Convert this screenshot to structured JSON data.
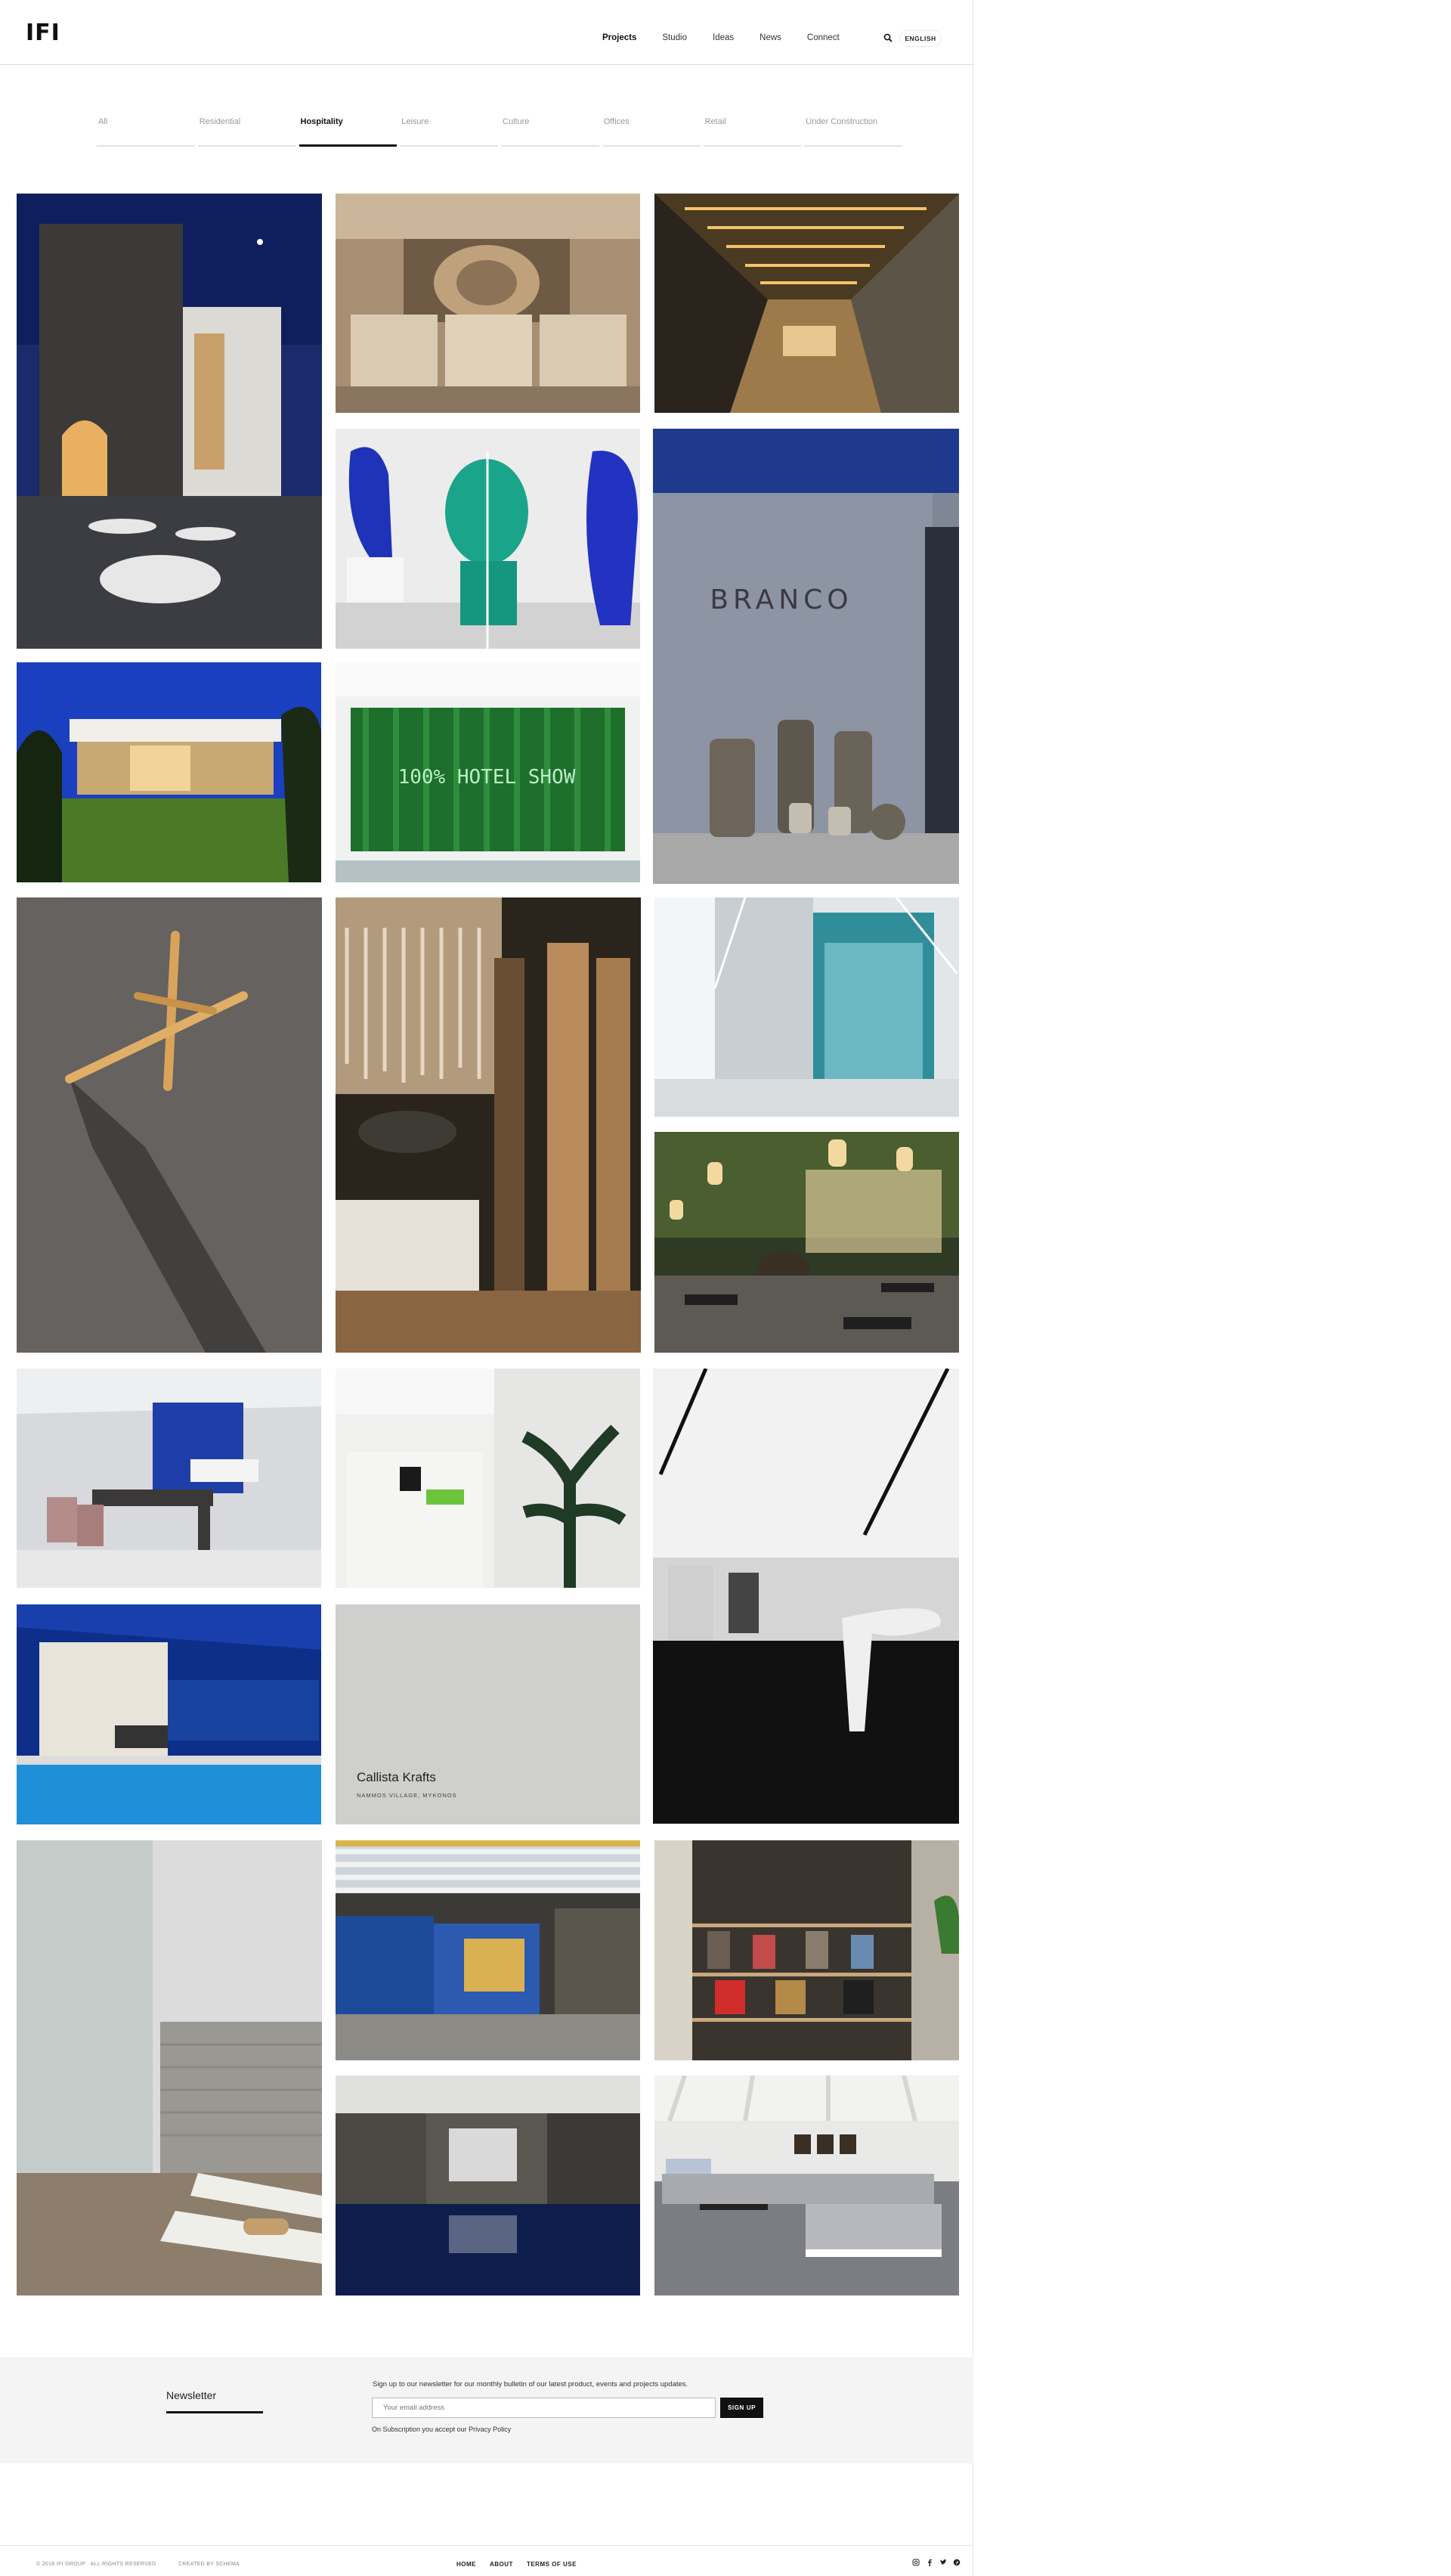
{
  "header": {
    "logo": "IFI",
    "nav": [
      "Projects",
      "Studio",
      "Ideas",
      "News",
      "Connect"
    ],
    "active_nav": "Projects",
    "language": "ENGLISH"
  },
  "filters": {
    "items": [
      "All",
      "Residential",
      "Hospitality",
      "Leisure",
      "Culture",
      "Offices",
      "Retail",
      "Under Construction"
    ],
    "active": "Hospitality"
  },
  "projects": {
    "featured_caption": {
      "title": "Callista Krafts",
      "location": "NAMMOS VILLAGE, MYKONOS"
    }
  },
  "newsletter": {
    "title": "Newsletter",
    "intro": "Sign up to our newsletter for our monthly bulletin of our latest product, events and projects updates.",
    "placeholder": "Your email address",
    "button": "SIGN UP",
    "note": "On Subscription you accept our Privacy Policy"
  },
  "footer": {
    "copyright": "© 2018 IFI GROUP · ALL RIGHTS RESERVED",
    "credit": "CREATED BY SCHEMA",
    "links": [
      "HOME",
      "ABOUT",
      "TERMS OF USE"
    ],
    "social_icons": [
      "instagram-icon",
      "facebook-icon",
      "twitter-icon",
      "pinterest-icon"
    ]
  }
}
